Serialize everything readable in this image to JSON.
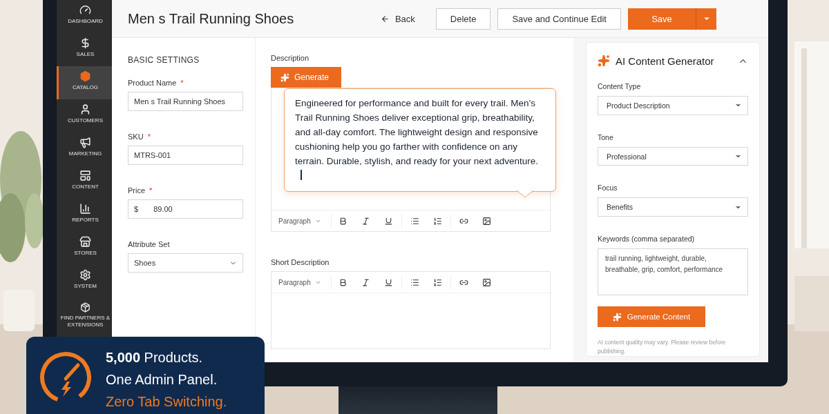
{
  "sidebar": {
    "items": [
      {
        "label": "DASHBOARD",
        "selected": false
      },
      {
        "label": "SALES",
        "selected": false
      },
      {
        "label": "CATALOG",
        "selected": true
      },
      {
        "label": "CUSTOMERS",
        "selected": false
      },
      {
        "label": "MARKETING",
        "selected": false
      },
      {
        "label": "CONTENT",
        "selected": false
      },
      {
        "label": "REPORTS",
        "selected": false
      },
      {
        "label": "STORES",
        "selected": false
      },
      {
        "label": "SYSTEM",
        "selected": false
      },
      {
        "label": "FIND PARTNERS & EXTENSIONS",
        "selected": false
      }
    ]
  },
  "header": {
    "title": "Men s Trail Running Shoes",
    "actions": [
      {
        "label": "Back",
        "kind": "back"
      },
      {
        "label": "Delete",
        "kind": "secondary"
      },
      {
        "label": "Save and Continue Edit",
        "kind": "secondary"
      },
      {
        "label": "Save",
        "kind": "primary"
      }
    ]
  },
  "basic_settings": {
    "heading": "BASIC SETTINGS",
    "fields": [
      {
        "label": "Product Name",
        "required_mark": "*",
        "value": "Men s Trail Running Shoes",
        "kind": "text"
      },
      {
        "label": "SKU",
        "required_mark": "*",
        "value": "MTRS-001",
        "kind": "text"
      },
      {
        "label": "Price",
        "required_mark": "*",
        "prefix": "$",
        "value": "89.00",
        "kind": "price"
      },
      {
        "label": "Attribute Set",
        "value": "Shoes",
        "kind": "select"
      }
    ]
  },
  "description": {
    "label": "Description",
    "generate_button": "Generate",
    "generated_text": "Engineered for performance and built for every trail. Men’s Trail Running Shoes deliver exceptional grip, breathability, and all-day comfort. The lightweight design and responsive cushioning help you go farther with confidence on any terrain. Durable, stylish, and ready for your next adventure.",
    "toolbar": {
      "format": "Paragraph"
    }
  },
  "short_description": {
    "label": "Short Description",
    "toolbar": {
      "format": "Paragraph"
    }
  },
  "ai_panel": {
    "title": "AI Content Generator",
    "expanded": true,
    "fields": [
      {
        "label": "Content Type",
        "value": "Product Description",
        "kind": "select"
      },
      {
        "label": "Tone",
        "value": "Professional",
        "kind": "select"
      },
      {
        "label": "Focus",
        "value": "Benefits",
        "kind": "select"
      },
      {
        "label": "Keywords (comma separated)",
        "value": "trail running, lightweight, durable, breathable, grip, comfort, performance",
        "kind": "textarea"
      }
    ],
    "button": "Generate Content",
    "note": "AI content quality may vary. Please review before publishing."
  },
  "banner": {
    "lines": [
      {
        "text": "**5,000** Products.",
        "kind": "plain"
      },
      {
        "text": "One Admin Panel.",
        "kind": "plain"
      },
      {
        "text": "Zero Tab Switching.",
        "kind": "accent"
      }
    ]
  }
}
